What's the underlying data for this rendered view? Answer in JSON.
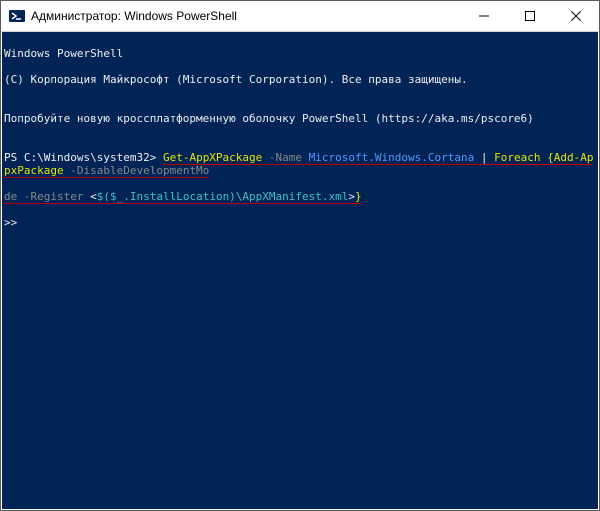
{
  "titlebar": {
    "title": "Администратор: Windows PowerShell"
  },
  "console": {
    "banner_line1": "Windows PowerShell",
    "banner_line2": "(C) Корпорация Майкрософт (Microsoft Corporation). Все права защищены.",
    "banner_blank": "",
    "banner_line3": "Попробуйте новую кроссплатформенную оболочку PowerShell (https://aka.ms/pscore6)",
    "prompt_prefix": "PS C:\\Windows\\system32> ",
    "cmd": {
      "get_pkg": "Get-AppXPackage",
      "name_flag": " -Name ",
      "name_val": "Microsoft.Windows.Cortana",
      "pipe": " | ",
      "foreach": "Foreach ",
      "brace_open": "{",
      "add_pkg": "Add-AppxPackage",
      "disable_flag": " -DisableDevelopmentMo",
      "de_flag": "de ",
      "register_flag": "-Register ",
      "lt": "<",
      "dollar_expr": "$($_.InstallLocation)\\AppXManifest.xml",
      "gt": ">",
      "brace_close": "}"
    },
    "continuation": ">>"
  }
}
